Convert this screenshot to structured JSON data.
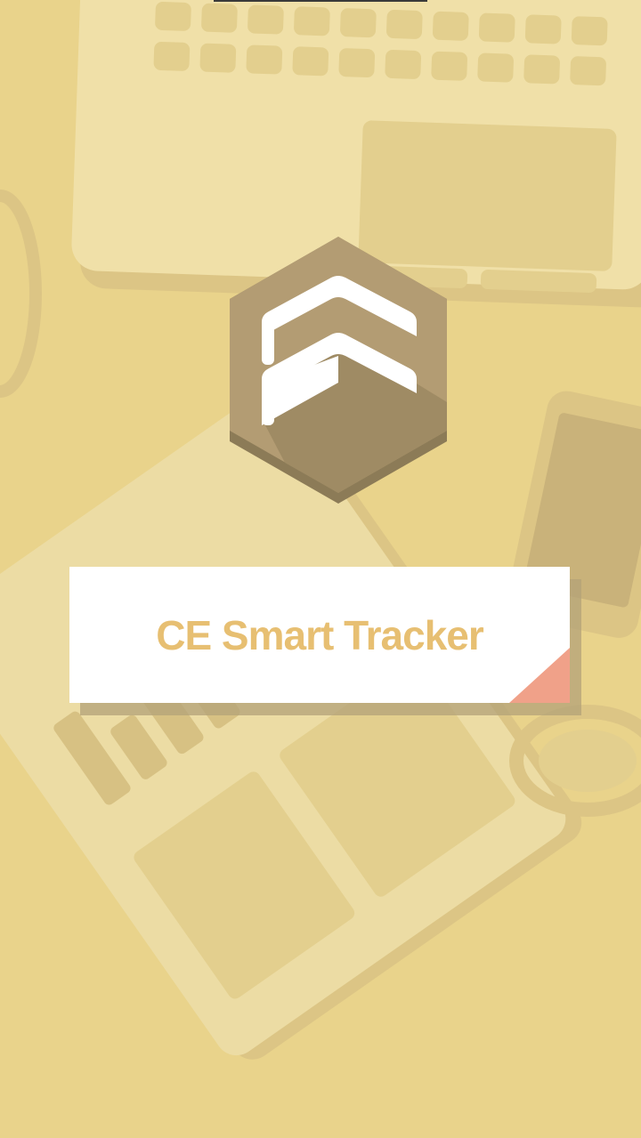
{
  "app": {
    "title": "CE Smart Tracker"
  },
  "logo": {
    "icon": "double-chevron-up-hexagon-icon"
  },
  "colors": {
    "background": "#e9d38b",
    "hexagon": "#b39c73",
    "hexagon_shadow": "#9c8a64",
    "title_text": "#e7bf72",
    "accent_corner": "#f0a189",
    "card": "#ffffff"
  }
}
